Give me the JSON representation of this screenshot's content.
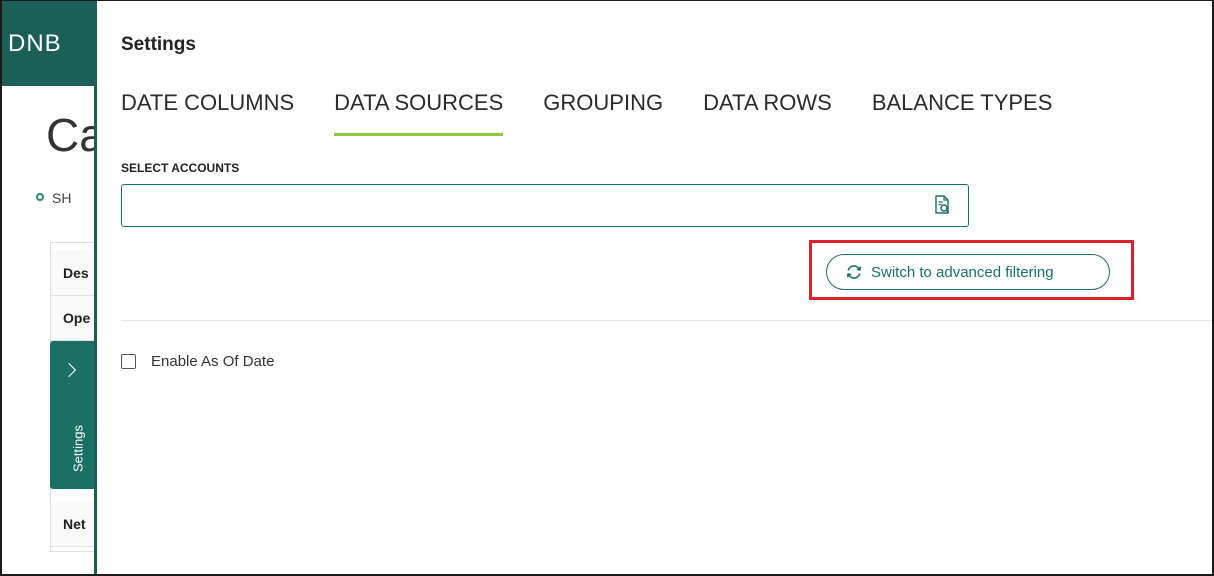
{
  "background": {
    "logo": "DNB",
    "page_title_partial": "Ca",
    "status_partial": "SH",
    "table_rows": [
      "Des",
      "Ope",
      "Net"
    ]
  },
  "settings_tab": {
    "label": "Settings"
  },
  "panel": {
    "title": "Settings",
    "tabs": [
      {
        "label": "DATE COLUMNS",
        "active": false
      },
      {
        "label": "DATA SOURCES",
        "active": true
      },
      {
        "label": "GROUPING",
        "active": false
      },
      {
        "label": "DATA ROWS",
        "active": false
      },
      {
        "label": "BALANCE TYPES",
        "active": false
      }
    ],
    "select_accounts": {
      "label": "SELECT ACCOUNTS",
      "value": "",
      "placeholder": ""
    },
    "advanced_filter_button": "Switch to advanced filtering",
    "enable_as_of_date": {
      "label": "Enable As Of Date",
      "checked": false
    }
  },
  "colors": {
    "brand_teal": "#1b7066",
    "header_teal": "#1b5f57",
    "active_tab_underline": "#8dc63f",
    "highlight_red": "#e0202a"
  }
}
